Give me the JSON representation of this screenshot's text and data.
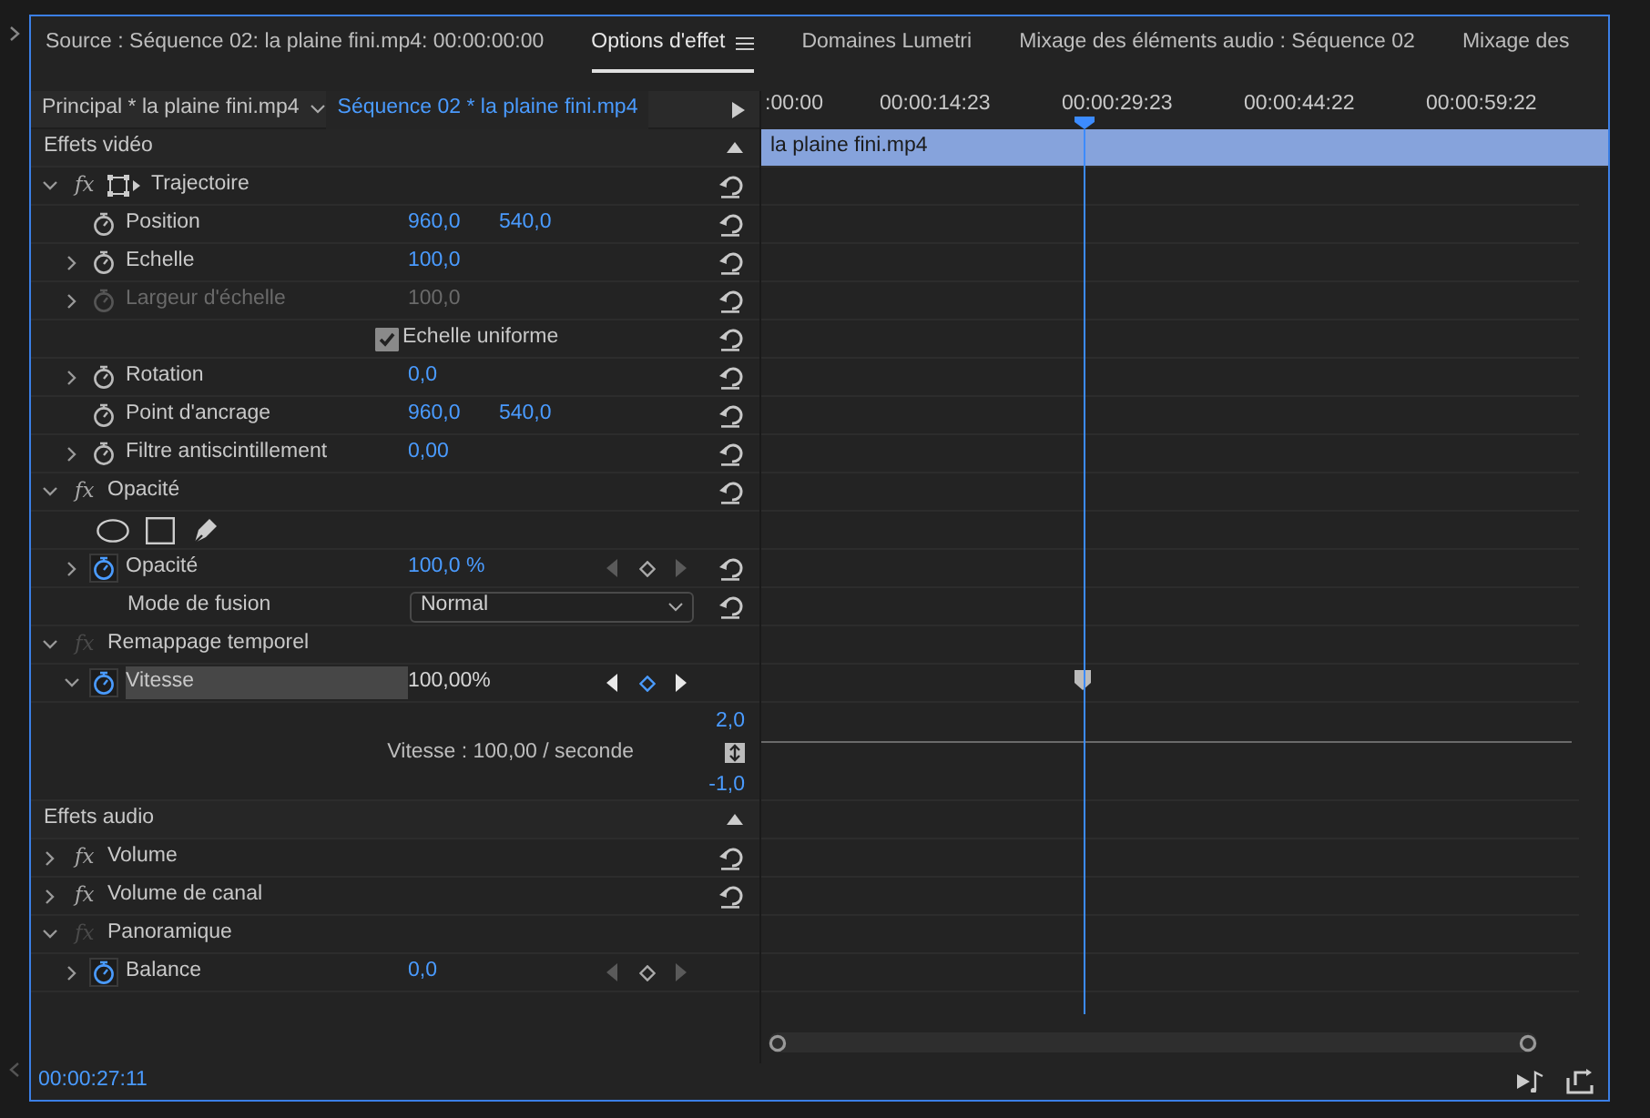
{
  "tabs": [
    {
      "label": "Source : Séquence 02: la plaine fini.mp4: 00:00:00:00",
      "selected": false
    },
    {
      "label": "Options d'effet",
      "selected": true
    },
    {
      "label": "Domaines Lumetri",
      "selected": false
    },
    {
      "label": "Mixage des éléments audio : Séquence 02",
      "selected": false
    },
    {
      "label": "Mixage des",
      "selected": false
    }
  ],
  "clip_tabs": [
    {
      "label": "Principal * la plaine fini.mp4",
      "selected": false
    },
    {
      "label": "Séquence 02 * la plaine fini.mp4",
      "selected": true
    }
  ],
  "ruler": [
    ":00:00",
    "00:00:14:23",
    "00:00:29:23",
    "00:00:44:22",
    "00:00:59:22"
  ],
  "sections": [
    {
      "title": "Effets vidéo",
      "clip": "la plaine fini.mp4",
      "effects": [
        {
          "name": "Trajectoire",
          "fx": "fx",
          "expanded": true,
          "fx_enabled": true,
          "transform_icon": true,
          "reset": true,
          "properties": [
            {
              "kind": "value",
              "name": "Position",
              "expandable": false,
              "disabled": false,
              "animated": false,
              "selected": false,
              "values": [
                "960,0",
                "540,0"
              ],
              "reset": true
            },
            {
              "kind": "value",
              "name": "Echelle",
              "expandable": true,
              "expanded": false,
              "disabled": false,
              "animated": false,
              "selected": false,
              "values": [
                "100,0"
              ],
              "reset": true
            },
            {
              "kind": "value",
              "name": "Largeur d'échelle",
              "expandable": true,
              "expanded": false,
              "disabled": true,
              "animated": false,
              "selected": false,
              "values": [
                "100,0"
              ],
              "reset": true
            },
            {
              "kind": "checkbox",
              "name": "Echelle uniforme",
              "checked": true,
              "reset": true
            },
            {
              "kind": "value",
              "name": "Rotation",
              "expandable": true,
              "expanded": false,
              "disabled": false,
              "animated": false,
              "selected": false,
              "values": [
                "0,0"
              ],
              "reset": true
            },
            {
              "kind": "value",
              "name": "Point d'ancrage",
              "expandable": false,
              "disabled": false,
              "animated": false,
              "selected": false,
              "values": [
                "960,0",
                "540,0"
              ],
              "reset": true
            },
            {
              "kind": "value",
              "name": "Filtre antiscintillement",
              "expandable": true,
              "expanded": false,
              "disabled": false,
              "animated": false,
              "selected": false,
              "values": [
                "0,00"
              ],
              "reset": true
            }
          ]
        },
        {
          "name": "Opacité",
          "fx": "fx",
          "expanded": true,
          "fx_enabled": true,
          "reset": true,
          "properties": [
            {
              "kind": "masks"
            },
            {
              "kind": "value",
              "name": "Opacité",
              "expandable": true,
              "expanded": false,
              "disabled": false,
              "animated": true,
              "selected": false,
              "values": [
                "100,0 %"
              ],
              "keyframes": true,
              "keyframe_active": false,
              "reset": true
            },
            {
              "kind": "dropdown",
              "name": "Mode de fusion",
              "value": "Normal",
              "reset": true
            }
          ]
        },
        {
          "name": "Remappage temporel",
          "fx": "fx",
          "expanded": true,
          "fx_enabled": false,
          "reset": false,
          "properties": [
            {
              "kind": "value",
              "name": "Vitesse",
              "expandable": true,
              "expanded": true,
              "disabled": false,
              "animated": true,
              "selected": true,
              "values": [
                "100,00%"
              ],
              "keyframes": true,
              "keyframe_active": true,
              "reset": false,
              "timeline_keyframe": true,
              "graph": {
                "max": "2,0",
                "label": "Vitesse : 100,00 / seconde",
                "min": "-1,0"
              }
            }
          ]
        }
      ]
    },
    {
      "title": "Effets audio",
      "effects": [
        {
          "name": "Volume",
          "fx": "fx",
          "expanded": false,
          "fx_enabled": true,
          "reset": true
        },
        {
          "name": "Volume de canal",
          "fx": "fx",
          "expanded": false,
          "fx_enabled": true,
          "reset": true
        },
        {
          "name": "Panoramique",
          "fx": "fx",
          "expanded": true,
          "fx_enabled": false,
          "reset": false,
          "properties": [
            {
              "kind": "value",
              "name": "Balance",
              "expandable": true,
              "expanded": false,
              "disabled": false,
              "animated": true,
              "selected": false,
              "values": [
                "0,0"
              ],
              "keyframes": true,
              "keyframe_active": false,
              "reset": false
            }
          ]
        }
      ]
    }
  ],
  "timecode": "00:00:27:11"
}
